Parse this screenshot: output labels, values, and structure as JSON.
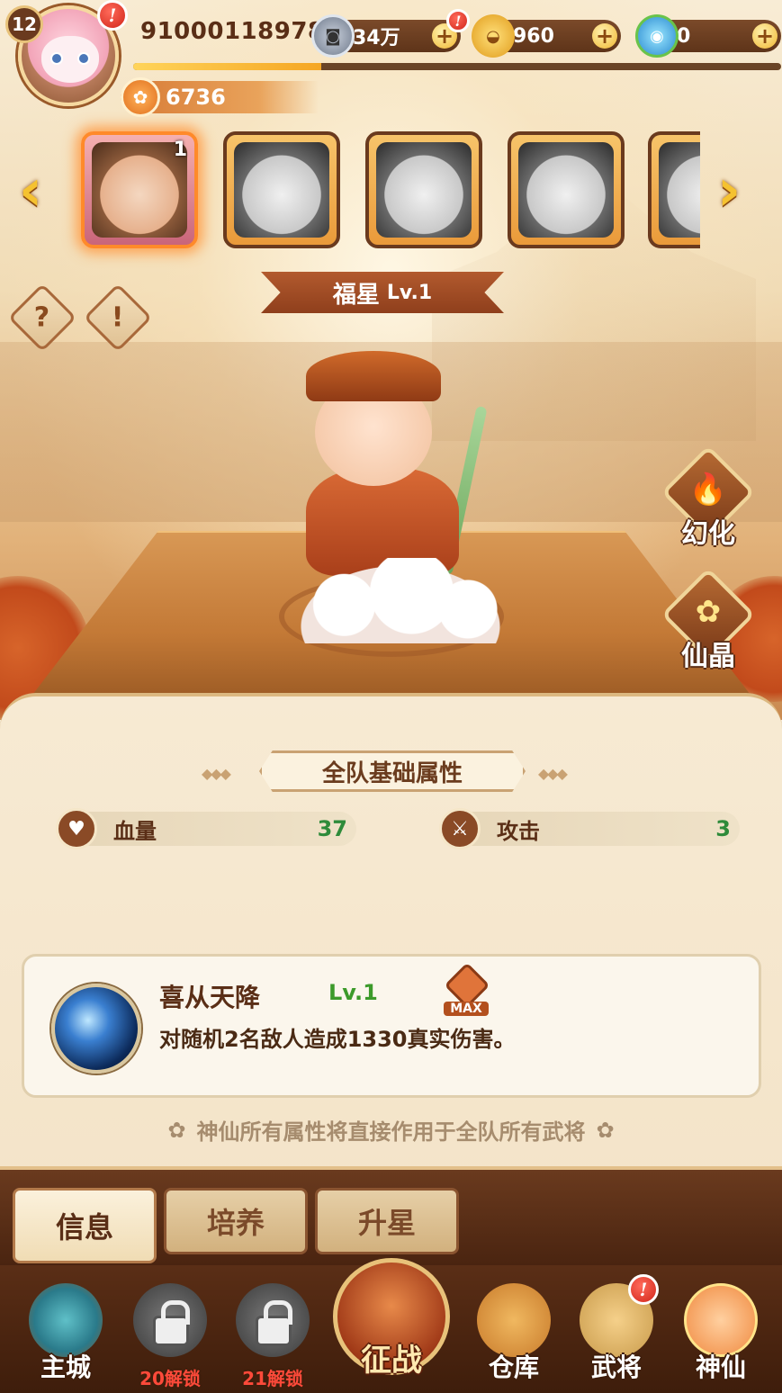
{
  "player": {
    "level": "12",
    "id": "91000118978",
    "exp_fraction": 0.29,
    "paw_points": "6736"
  },
  "resources": {
    "coins": {
      "icon": "copper-coin-icon",
      "value": "34万"
    },
    "gold": {
      "icon": "gold-ingot-icon",
      "value": "960"
    },
    "gems": {
      "icon": "jade-orb-icon",
      "value": "0"
    },
    "plus_symbol": "+"
  },
  "alert_symbol": "!",
  "carousel": {
    "prev_symbol": "‹",
    "next_symbol": "›",
    "selected_level": "1"
  },
  "hero": {
    "name": "福星",
    "level": "Lv.1"
  },
  "help": {
    "question_symbol": "?",
    "info_symbol": "!"
  },
  "side_buttons": {
    "transform": "幻化",
    "crystal": "仙晶"
  },
  "stats": {
    "title": "全队基础属性",
    "hp_label": "血量",
    "hp_value": "37",
    "atk_label": "攻击",
    "atk_value": "3"
  },
  "skill": {
    "name": "喜从天降",
    "level": "Lv.1",
    "max_label": "MAX",
    "description": "对随机2名敌人造成1330真实伤害。"
  },
  "note": "神仙所有属性将直接作用于全队所有武将",
  "tabs": [
    "信息",
    "培养",
    "升星"
  ],
  "nav": {
    "main_city": "主城",
    "unlock_20": "20解锁",
    "unlock_21": "21解锁",
    "battle": "征战",
    "warehouse": "仓库",
    "generals": "武将",
    "immortals": "神仙"
  },
  "colors": {
    "accent": "#f5a623",
    "stat_value": "#2e8b3a",
    "skill_level": "#3c9a2a",
    "unlock_text": "#ff4a3a"
  }
}
